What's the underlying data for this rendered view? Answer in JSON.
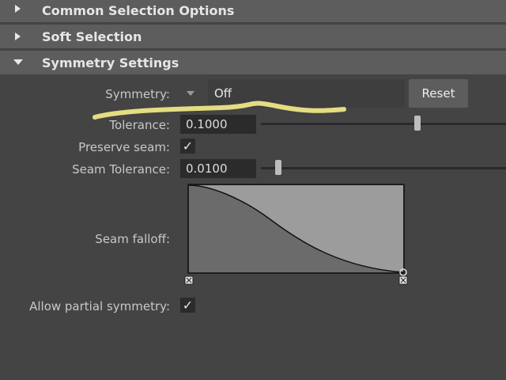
{
  "sections": {
    "common": {
      "title": "Common Selection Options",
      "expanded": false
    },
    "soft": {
      "title": "Soft Selection",
      "expanded": false
    },
    "symmetry": {
      "title": "Symmetry Settings",
      "expanded": true
    }
  },
  "symmetry": {
    "label": "Symmetry:",
    "value": "Off",
    "reset_label": "Reset"
  },
  "tolerance": {
    "label": "Tolerance:",
    "value": "0.1000",
    "slider_fraction": 0.45
  },
  "preserve_seam": {
    "label": "Preserve seam:",
    "checked": true
  },
  "seam_tolerance": {
    "label": "Seam Tolerance:",
    "value": "0.0100",
    "slider_fraction": 0.05
  },
  "seam_falloff": {
    "label": "Seam falloff:"
  },
  "allow_partial": {
    "label": "Allow partial symmetry:",
    "checked": true
  },
  "colors": {
    "section_bg": "#5d5d5d",
    "panel_bg": "#444444",
    "field_bg": "#2b2b2b",
    "highlight_stroke": "#f6ee8a"
  }
}
